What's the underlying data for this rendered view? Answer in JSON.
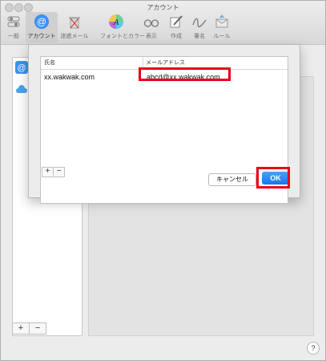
{
  "window": {
    "title": "アカウント"
  },
  "toolbar": {
    "items": [
      {
        "label": "一般",
        "icon": "switch-icon",
        "active": false
      },
      {
        "label": "アカウント",
        "icon": "at-sign-icon",
        "active": true
      },
      {
        "label": "迷惑メール",
        "icon": "trash-icon",
        "active": false
      },
      {
        "label": "フォントとカラー",
        "icon": "font-color-icon",
        "active": false
      },
      {
        "label": "表示",
        "icon": "glasses-icon",
        "active": false
      },
      {
        "label": "作成",
        "icon": "compose-icon",
        "active": false
      },
      {
        "label": "署名",
        "icon": "signature-icon",
        "active": false
      },
      {
        "label": "ルール",
        "icon": "rules-icon",
        "active": false
      }
    ]
  },
  "sidebar": {
    "accounts": [
      {
        "icon": "at-sign-icon"
      },
      {
        "icon": "cloud-icon"
      }
    ],
    "add_label": "+",
    "remove_label": "−"
  },
  "sheet": {
    "columns": [
      "氏名",
      "メールアドレス"
    ],
    "rows": [
      {
        "name": "xx.wakwak.com",
        "email": "abcd@xx.wakwak.com"
      }
    ],
    "add_label": "+",
    "remove_label": "−",
    "cancel_label": "キャンセル",
    "ok_label": "OK"
  },
  "help_label": "?",
  "colors": {
    "highlight": "#e8001c",
    "accent": "#1775f0"
  }
}
